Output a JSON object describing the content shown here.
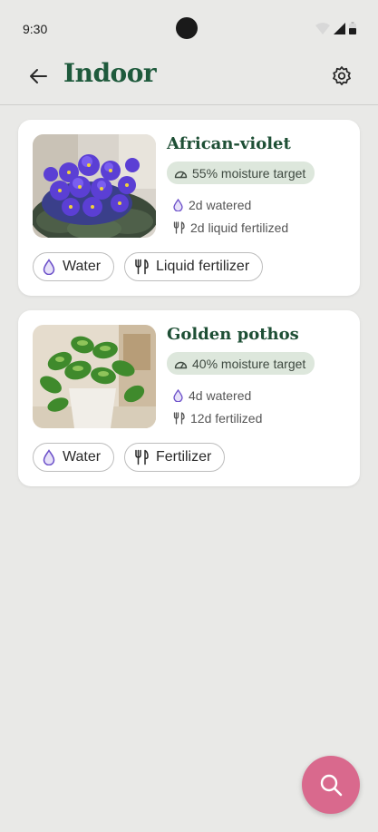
{
  "status_bar": {
    "time": "9:30"
  },
  "header": {
    "title": "Indoor"
  },
  "plants": [
    {
      "name": "African-violet",
      "moisture": "55% moisture target",
      "watered": "2d watered",
      "fertilized": "2d liquid fertilized",
      "actions": {
        "water": "Water",
        "fertilize": "Liquid fertilizer"
      }
    },
    {
      "name": "Golden pothos",
      "moisture": "40% moisture target",
      "watered": "4d watered",
      "fertilized": "12d fertilized",
      "actions": {
        "water": "Water",
        "fertilize": "Fertilizer"
      }
    }
  ],
  "icons": {
    "back": "arrow-left-icon",
    "settings": "gear-icon",
    "moisture": "gauge-icon",
    "water": "water-drop-icon",
    "fertilizer": "fork-knife-icon",
    "fab": "search-icon"
  },
  "colors": {
    "title": "#1e5a3c",
    "chip_bg": "#dde7dc",
    "fab": "#d9698d",
    "drop": "#6b4fc9",
    "background": "#e9e9e7"
  }
}
